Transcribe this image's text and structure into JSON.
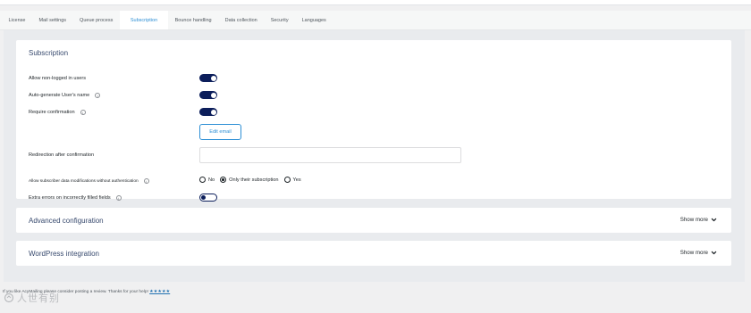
{
  "tabs": [
    "License",
    "Mail settings",
    "Queue process",
    "Subscription",
    "Bounce handling",
    "Data collection",
    "Security",
    "Languages"
  ],
  "active_tab": "Subscription",
  "subscription": {
    "title": "Subscription",
    "allow_non_logged": {
      "label": "Allow non-logged in users",
      "enabled": true
    },
    "auto_generate_name": {
      "label": "Auto-generate User's name",
      "enabled": true
    },
    "require_confirmation": {
      "label": "Require confirmation",
      "enabled": true
    },
    "edit_email_label": "Edit email",
    "redirection_label": "Redirection after confirmation",
    "redirection_value": "",
    "allow_modifications": {
      "label": "Allow subscriber data modifications without authentication",
      "options": [
        "No",
        "Only their subscription",
        "Yes"
      ],
      "selected": "Only their subscription"
    },
    "extra_errors": {
      "label": "Extra errors on incorrectly filled fields",
      "enabled": false
    }
  },
  "advanced": {
    "title": "Advanced configuration",
    "show_more": "Show more"
  },
  "wordpress": {
    "title": "WordPress integration",
    "show_more": "Show more"
  },
  "footer": {
    "text": "If you like AcyMailing please consider posting a review. Thanks for your help!",
    "stars": "★★★★★"
  },
  "colors": {
    "accent": "#2d8fd5",
    "toggle": "#0c1e5b",
    "title": "#384a6e"
  },
  "icons": {
    "info": "info-icon",
    "chevron": "chevron-down-icon"
  },
  "watermark": "人世有别"
}
